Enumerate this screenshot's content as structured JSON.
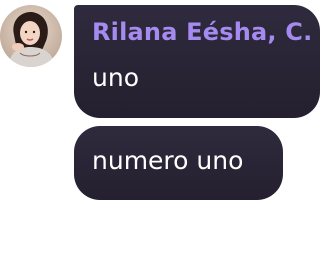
{
  "chat": {
    "avatar_icon": "user-avatar-photo",
    "sender_color": "#a58af0",
    "bubble_color": "#2a2636",
    "messages": [
      {
        "sender": "Rilana Eésha, C.",
        "text": "uno"
      },
      {
        "text": "numero uno"
      }
    ]
  }
}
